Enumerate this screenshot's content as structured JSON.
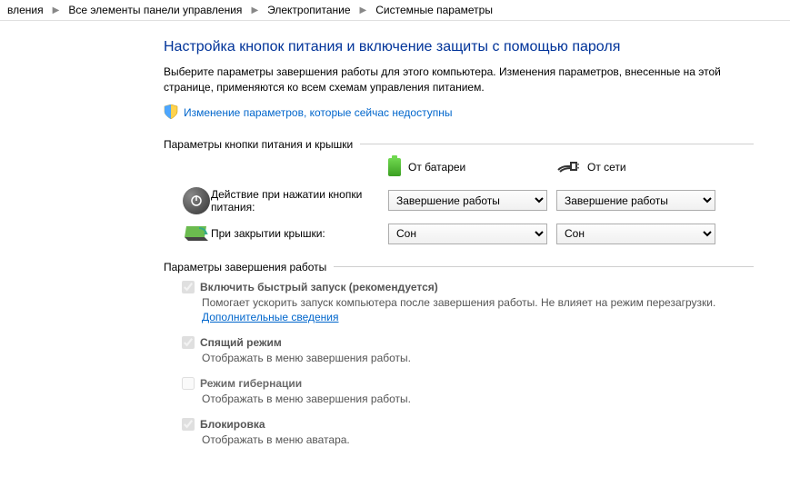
{
  "breadcrumb": {
    "b0": "вления",
    "b1": "Все элементы панели управления",
    "b2": "Электропитание",
    "b3": "Системные параметры"
  },
  "title": "Настройка кнопок питания и включение защиты с помощью пароля",
  "desc": "Выберите параметры завершения работы для этого компьютера. Изменения параметров, внесенные на этой странице, применяются ко всем схемам управления питанием.",
  "shield_link": "Изменение параметров, которые сейчас недоступны",
  "section1": "Параметры кнопки питания и крышки",
  "col_battery": "От батареи",
  "col_ac": "От сети",
  "row1_label": "Действие при нажатии кнопки питания:",
  "row2_label": "При закрытии крышки:",
  "sel_shutdown": "Завершение работы",
  "sel_sleep": "Сон",
  "section2": "Параметры завершения работы",
  "opt1": {
    "title": "Включить быстрый запуск (рекомендуется)",
    "desc1": "Помогает ускорить запуск компьютера после завершения работы. Не влияет на режим перезагрузки. ",
    "link": "Дополнительные сведения"
  },
  "opt2": {
    "title": "Спящий режим",
    "desc": "Отображать в меню завершения работы."
  },
  "opt3": {
    "title": "Режим гибернации",
    "desc": "Отображать в меню завершения работы."
  },
  "opt4": {
    "title": "Блокировка",
    "desc": "Отображать в меню аватара."
  }
}
